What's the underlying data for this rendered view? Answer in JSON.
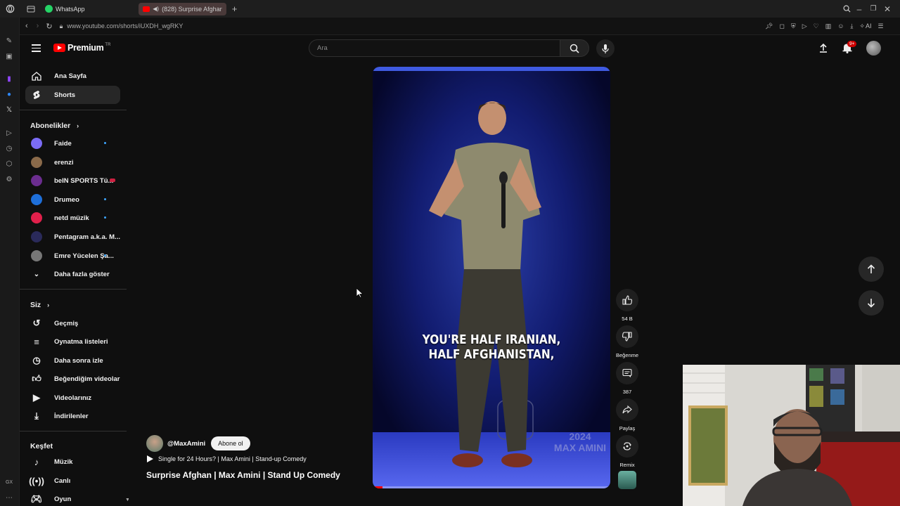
{
  "browser": {
    "tabs": [
      {
        "label": "WhatsApp"
      },
      {
        "label": "(828) Surprise Afghan"
      }
    ],
    "url": "www.youtube.com/shorts/iUXDH_wgRKY",
    "ai_label": "AI",
    "rail_bottom_label": "GX"
  },
  "masthead": {
    "logo_text": "Premium",
    "logo_region": "TR",
    "search_placeholder": "Ara",
    "notification_badge": "9+"
  },
  "sidebar": {
    "main": [
      {
        "label": "Ana Sayfa",
        "icon": "home-icon"
      },
      {
        "label": "Shorts",
        "icon": "shorts-icon"
      }
    ],
    "subscriptions_title": "Abonelikler",
    "subscriptions": [
      {
        "label": "Faide",
        "color": "#7b6cf6",
        "new": true
      },
      {
        "label": "erenzi",
        "color": "#8a6a4a",
        "new": false
      },
      {
        "label": "beIN SPORTS Tü...",
        "color": "#6b2d8f",
        "live": true
      },
      {
        "label": "Drumeo",
        "color": "#1e6fd9",
        "new": true
      },
      {
        "label": "netd müzik",
        "color": "#e0204b",
        "new": true
      },
      {
        "label": "Pentagram a.k.a. M...",
        "color": "#2a2a5a",
        "new": false
      },
      {
        "label": "Emre Yücelen Şa...",
        "color": "#777777",
        "new": true
      }
    ],
    "show_more": "Daha fazla göster",
    "you_title": "Siz",
    "you_items": [
      {
        "label": "Geçmiş",
        "icon": "history-icon"
      },
      {
        "label": "Oynatma listeleri",
        "icon": "playlists-icon"
      },
      {
        "label": "Daha sonra izle",
        "icon": "watch-later-icon"
      },
      {
        "label": "Beğendiğim videolar",
        "icon": "liked-videos-icon"
      },
      {
        "label": "Videolarınız",
        "icon": "your-videos-icon"
      },
      {
        "label": "İndirilenler",
        "icon": "downloads-icon"
      }
    ],
    "explore_title": "Keşfet",
    "explore_items": [
      {
        "label": "Müzik",
        "icon": "music-icon"
      },
      {
        "label": "Canlı",
        "icon": "live-icon"
      },
      {
        "label": "Oyun",
        "icon": "gaming-icon"
      }
    ]
  },
  "short": {
    "caption_line1": "YOU'RE HALF IRANIAN,",
    "caption_line2": "HALF AFGHANISTAN,",
    "watermark_year": "2024",
    "watermark_name": "MAX AMINI",
    "channel": "@MaxAmini",
    "subscribe": "Abone ol",
    "playlist_link": "Single for 24 Hours? | Max Amini | Stand-up Comedy",
    "title": "Surprise Afghan | Max Amini | Stand Up Comedy",
    "progress": 0.04
  },
  "actions": {
    "likes": "54 B",
    "dislike": "Beğenme",
    "comments": "387",
    "share": "Paylaş",
    "remix": "Remix"
  }
}
